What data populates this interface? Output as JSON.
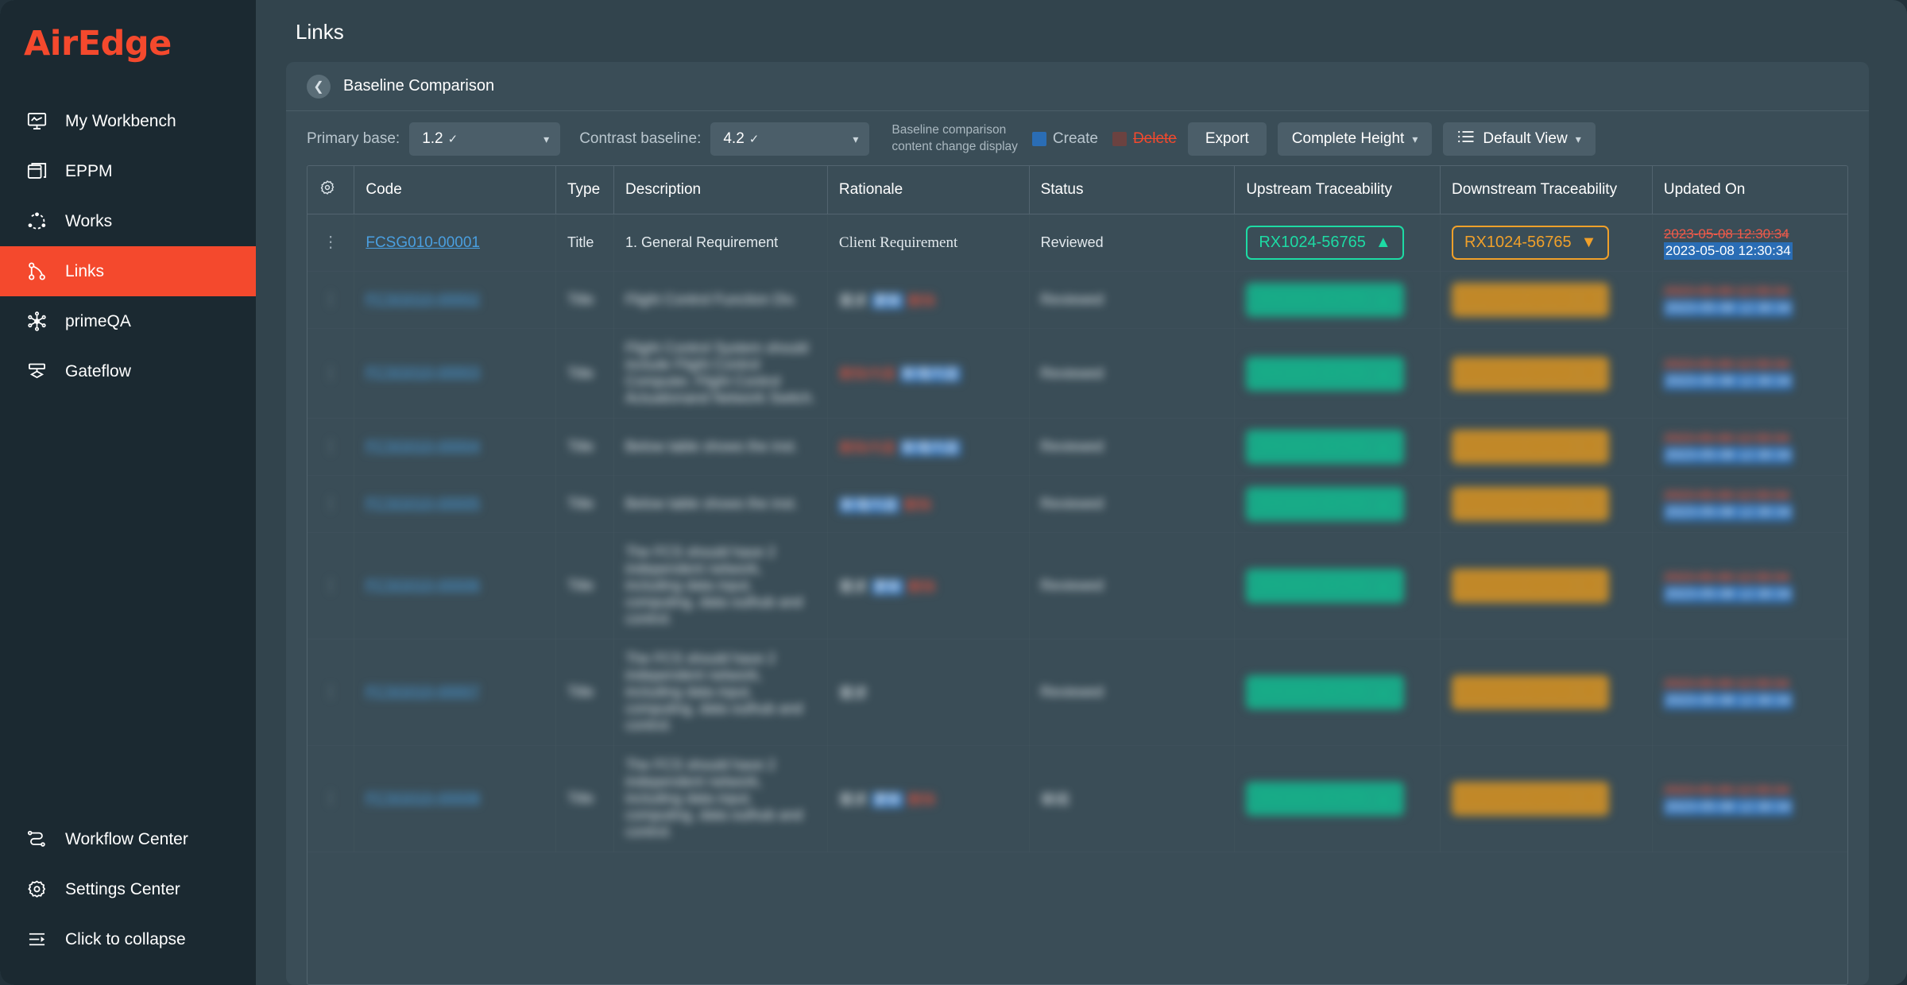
{
  "sidebar": {
    "logo": "AirEdge",
    "items": [
      {
        "label": "My Workbench",
        "icon": "monitor-chart-icon",
        "active": false
      },
      {
        "label": "EPPM",
        "icon": "stack-window-icon",
        "active": false
      },
      {
        "label": "Works",
        "icon": "nodes-circle-icon",
        "active": false
      },
      {
        "label": "Links",
        "icon": "link-tree-icon",
        "active": true
      },
      {
        "label": "primeQA",
        "icon": "asterisk-nodes-icon",
        "active": false
      },
      {
        "label": "Gateflow",
        "icon": "gate-diamond-icon",
        "active": false
      }
    ],
    "bottom_items": [
      {
        "label": "Workflow Center",
        "icon": "workflow-icon"
      },
      {
        "label": "Settings Center",
        "icon": "gear-icon"
      },
      {
        "label": "Click to collapse",
        "icon": "collapse-icon"
      }
    ]
  },
  "header": {
    "page_title": "Links"
  },
  "card": {
    "back_icon": "chevron-left-icon",
    "title": "Baseline Comparison"
  },
  "toolbar": {
    "primary_base_label": "Primary base:",
    "primary_base_value": "1.2",
    "contrast_baseline_label": "Contrast baseline:",
    "contrast_baseline_value": "4.2",
    "legend_note": "Baseline comparison\ncontent change display",
    "legend_create": "Create",
    "legend_delete": "Delete",
    "create_color": "#2a6db5",
    "delete_color": "#6b4240",
    "delete_text_color": "#f4492d",
    "export_label": "Export",
    "height_label": "Complete Height",
    "view_label": "Default View",
    "view_icon": "list-icon"
  },
  "table": {
    "columns": [
      {
        "key": "gear",
        "label": "",
        "icon": "gear-icon"
      },
      {
        "key": "code",
        "label": "Code"
      },
      {
        "key": "type",
        "label": "Type"
      },
      {
        "key": "description",
        "label": "Description"
      },
      {
        "key": "rationale",
        "label": "Rationale"
      },
      {
        "key": "status",
        "label": "Status"
      },
      {
        "key": "upstream",
        "label": "Upstream Traceability"
      },
      {
        "key": "downstream",
        "label": "Downstream Traceability"
      },
      {
        "key": "updated",
        "label": "Updated On"
      }
    ],
    "rows": [
      {
        "blurred": false,
        "code": "FCSG010-00001",
        "type": "Title",
        "description": "1. General Requirement",
        "rationale": "Client Requirement",
        "status": "Reviewed",
        "upstream": "RX1024-56765",
        "upstream_marker": "▲",
        "downstream": "RX1024-56765",
        "downstream_marker": "▼",
        "updated_deleted": "2023-05-08 12:30:34",
        "updated_created": "2023-05-08 12:30:34"
      },
      {
        "blurred": true,
        "code": "FCSG010-00002",
        "type": "Title",
        "description": "Flight Control Function Div.",
        "rationale": "需求 更新 删除",
        "status": "Reviewed",
        "upstream": "RX1024-56765",
        "upstream_marker": "▲",
        "downstream": "RX1024-56765",
        "downstream_marker": "▼",
        "updated_deleted": "2023-05-08 12:30:34",
        "updated_created": "2023-05-08 12:30:34"
      },
      {
        "blurred": true,
        "code": "FCSG010-00003",
        "type": "Title",
        "description": "Flight Control System should include Flight Control Computer, Flight Control Actuationand Network Switch.",
        "rationale": "删除内容 新增内容",
        "status": "Reviewed",
        "upstream": "RX1024-56765",
        "upstream_marker": "▲",
        "downstream": "RX1024-56765",
        "downstream_marker": "▼",
        "updated_deleted": "2023-05-08 12:30:34",
        "updated_created": "2023-05-08 12:30:34"
      },
      {
        "blurred": true,
        "code": "FCSG010-00004",
        "type": "Title",
        "description": "Below table shows the inst.",
        "rationale": "删除内容 新增内容",
        "status": "Reviewed",
        "upstream": "RX1024-56765",
        "upstream_marker": "▲",
        "downstream": "RX1024-56765",
        "downstream_marker": "▼",
        "updated_deleted": "2023-05-08 12:30:34",
        "updated_created": "2023-05-08 12:30:34"
      },
      {
        "blurred": true,
        "code": "FCSG010-00005",
        "type": "Title",
        "description": "Below table shows the inst.",
        "rationale": "新增内容 删除",
        "status": "Reviewed",
        "upstream": "RX1024-56765",
        "upstream_marker": "▲",
        "downstream": "RX1024-56765",
        "downstream_marker": "▼",
        "updated_deleted": "2023-05-08 12:30:34",
        "updated_created": "2023-05-08 12:30:34"
      },
      {
        "blurred": true,
        "code": "FCSG010-00006",
        "type": "Title",
        "description": "The FCS should have 2 independent network, including data input, computing, data outhub and control.",
        "rationale": "需求 更新 删除",
        "status": "Reviewed",
        "upstream": "RX1024-56765",
        "upstream_marker": "▲",
        "downstream": "RX1024-56765",
        "downstream_marker": "▼",
        "updated_deleted": "2023-05-08 12:30:34",
        "updated_created": "2023-05-08 12:30:34"
      },
      {
        "blurred": true,
        "code": "FCSG010-00007",
        "type": "Title",
        "description": "The FCS should have 2 independent network, including data input, computing, data outhub and control.",
        "rationale": "需求",
        "status": "Reviewed",
        "upstream": "RX1024-56765",
        "upstream_marker": "▲",
        "downstream": "RX1024-56765",
        "downstream_marker": "▼",
        "updated_deleted": "2023-05-08 12:30:34",
        "updated_created": "2023-05-08 12:30:34"
      },
      {
        "blurred": true,
        "code": "FCSG010-00008",
        "type": "Title",
        "description": "The FCS should have 2 independent network, including data input, computing, data outhub and control.",
        "rationale": "需求 更新 删除",
        "status": "审阅",
        "upstream": "RX1024-56765",
        "upstream_marker": "▲",
        "downstream": "RX1024-56765",
        "downstream_marker": "▼",
        "updated_deleted": "2023-05-08 12:30:34",
        "updated_created": "2023-05-08 12:30:34"
      }
    ]
  },
  "colors": {
    "brand": "#f4492d",
    "sidebar_bg": "#1b2931",
    "page_bg": "#32444d",
    "card_bg": "#3a4d57",
    "upstream": "#1ddba4",
    "downstream": "#f0a02a",
    "link": "#4a9fe0",
    "created_bg": "#2a6db5",
    "deleted_fg": "#f05a4a"
  }
}
